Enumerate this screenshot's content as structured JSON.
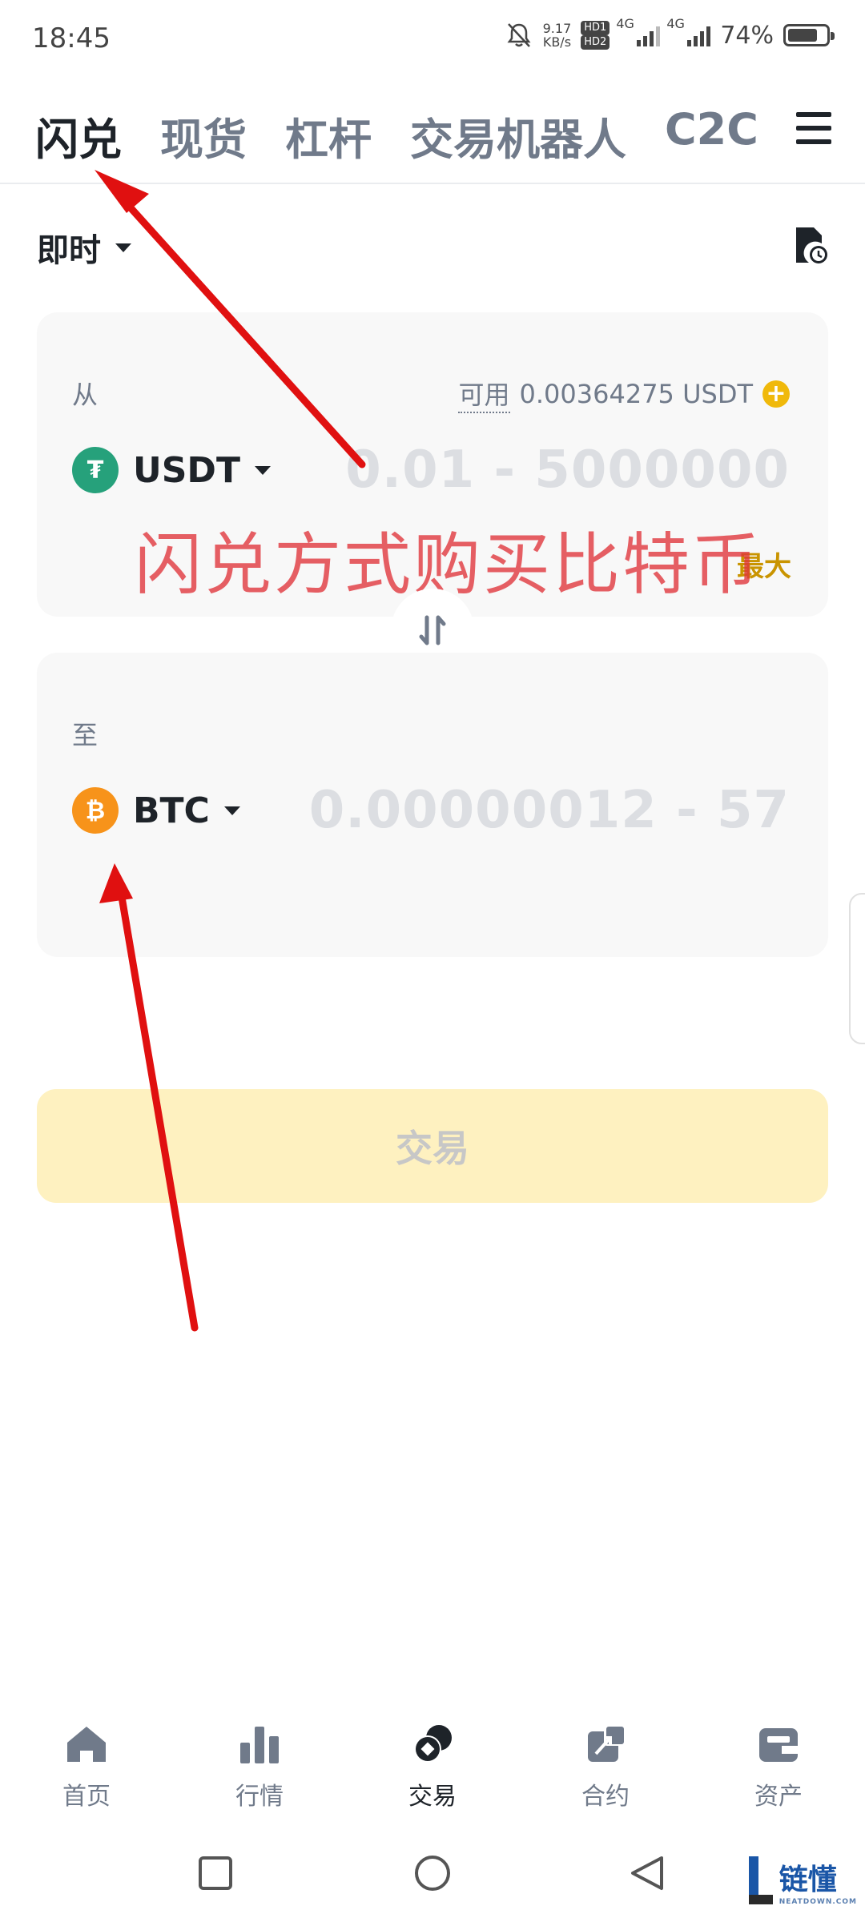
{
  "status_bar": {
    "time": "18:45",
    "net_speed_value": "9.17",
    "net_speed_unit": "KB/s",
    "hd1": "HD1",
    "hd2": "HD2",
    "signal1": "4G",
    "signal2": "4G",
    "battery": "74%"
  },
  "tabs": [
    "闪兑",
    "现货",
    "杠杆",
    "交易机器人",
    "C2C"
  ],
  "mode": {
    "label": "即时"
  },
  "from": {
    "label": "从",
    "available_label": "可用",
    "available_value": "0.00364275 USDT",
    "coin": "USDT",
    "coin_glyph": "₮",
    "amount_placeholder": "0.01 - 5000000",
    "max_label": "最大"
  },
  "to": {
    "label": "至",
    "coin": "BTC",
    "coin_glyph": "₿",
    "amount_placeholder": "0.00000012 - 57"
  },
  "annotation": {
    "text": "闪兑方式购买比特币"
  },
  "trade_button": "交易",
  "bottom_nav": [
    {
      "label": "首页",
      "icon": "home-icon"
    },
    {
      "label": "行情",
      "icon": "chart-bars-icon"
    },
    {
      "label": "交易",
      "icon": "trade-icon"
    },
    {
      "label": "合约",
      "icon": "futures-icon"
    },
    {
      "label": "资产",
      "icon": "wallet-icon"
    }
  ],
  "watermark": {
    "brand": "链懂",
    "sub": "NEATDOWN.COM"
  },
  "colors": {
    "accent": "#f0b90b",
    "usdt": "#26a17b",
    "btc": "#f7931a",
    "annotation": "#e0343a"
  }
}
